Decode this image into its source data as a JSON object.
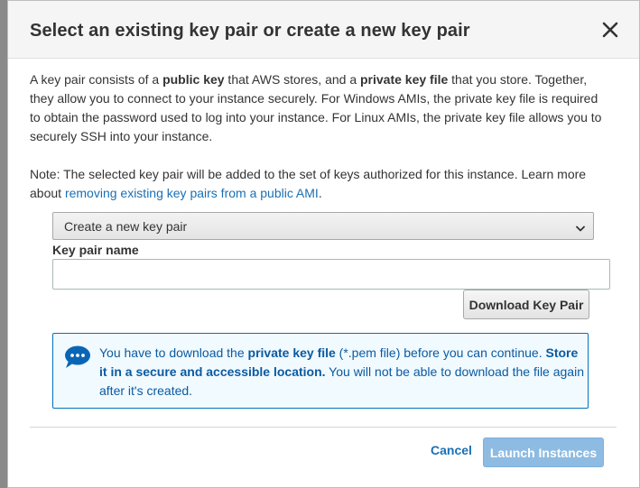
{
  "modal": {
    "title": "Select an existing key pair or create a new key pair",
    "intro": {
      "part1": "A key pair consists of a ",
      "bold1": "public key",
      "part2": " that AWS stores, and a ",
      "bold2": "private key file",
      "part3": " that you store. Together, they allow you to connect to your instance securely. For Windows AMIs, the private key file is required to obtain the password used to log into your instance. For Linux AMIs, the private key file allows you to securely SSH into your instance."
    },
    "note": {
      "text": "Note: The selected key pair will be added to the set of keys authorized for this instance. Learn more about ",
      "link": "removing existing key pairs from a public AMI",
      "end": "."
    },
    "key_pair_select": {
      "selected": "Create a new key pair"
    },
    "key_pair_name": {
      "label": "Key pair name",
      "value": "",
      "placeholder": ""
    },
    "download_label": "Download Key Pair",
    "info": {
      "part1": "You have to download the ",
      "bold1": "private key file",
      "part2": " (*.pem file) before you can continue. ",
      "bold2": "Store it in a secure and accessible location.",
      "part3": " You will not be able to download the file again after it's created.",
      "icon": "speech-bubble-icon",
      "accent": "#0073bb"
    },
    "cancel_label": "Cancel",
    "launch_label": "Launch Instances",
    "close_icon": "close-icon"
  },
  "colors": {
    "link": "#1a6fb5",
    "primary_disabled": "#8dbbe2",
    "info_bg": "#f1faff"
  }
}
